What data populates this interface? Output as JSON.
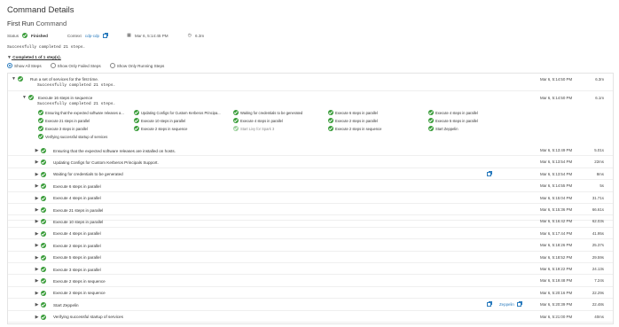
{
  "page": {
    "title": "Command Details",
    "run_name": "First Run",
    "run_kind": "Command"
  },
  "status_line": {
    "status_label": "Status",
    "status_value": "Finished",
    "context_label": "Context",
    "context_value": "cdp-cdp",
    "started": "Mar 6, 5:14:45 PM",
    "duration": "6.3m"
  },
  "summary": "Successfully completed 21 steps.",
  "completed_toggle": "Completed 1 of 1 step(s).",
  "filters": {
    "all": "Show All Steps",
    "failed": "Show Only Failed Steps",
    "running": "Show Only Running Steps"
  },
  "root": {
    "name": "Run a set of services for the first time.",
    "message": "Successfully completed 21 steps.",
    "time": "Mar 6, 5:14:50 PM",
    "duration": "6.3m"
  },
  "sequence": {
    "name": "Execute 16 steps in sequence",
    "message": "Successfully completed 21 steps.",
    "time": "Mar 6, 5:14:50 PM",
    "duration": "6.1m"
  },
  "grid": [
    {
      "label": "Ensuring that the expected software releases a...",
      "state": "ok"
    },
    {
      "label": "Updating Configs for Custom Kerberos Principa...",
      "state": "ok"
    },
    {
      "label": "Waiting for credentials to be generated",
      "state": "ok"
    },
    {
      "label": "Execute 6 steps in parallel",
      "state": "ok"
    },
    {
      "label": "Execute 4 steps in parallel",
      "state": "ok"
    },
    {
      "label": "Execute 21 steps in parallel",
      "state": "ok"
    },
    {
      "label": "Execute 10 steps in parallel",
      "state": "ok"
    },
    {
      "label": "Execute 4 steps in parallel",
      "state": "ok"
    },
    {
      "label": "Execute 2 steps in parallel",
      "state": "ok"
    },
    {
      "label": "Execute 5 steps in parallel",
      "state": "ok"
    },
    {
      "label": "Execute 3 steps in parallel",
      "state": "ok"
    },
    {
      "label": "Execute 2 steps in sequence",
      "state": "ok"
    },
    {
      "label": "Start Livy for Spark 3",
      "state": "gray"
    },
    {
      "label": "Execute 2 steps in sequence",
      "state": "ok"
    },
    {
      "label": "Start Zeppelin",
      "state": "ok"
    },
    {
      "label": "Verifying successful startup of services",
      "state": "ok"
    }
  ],
  "steps": [
    {
      "name": "Ensuring that the expected software releases are installed on hosts.",
      "time": "Mar 6, 5:13:49 PM",
      "duration": "5.01s"
    },
    {
      "name": "Updating Configs for Custom Kerberos Principals Support.",
      "time": "Mar 6, 5:13:54 PM",
      "duration": "22ms"
    },
    {
      "name": "Waiting for credentials to be generated",
      "time": "Mar 6, 5:13:54 PM",
      "duration": "8ms",
      "link_icon": true
    },
    {
      "name": "Execute 6 steps in parallel",
      "time": "Mar 6, 5:14:55 PM",
      "duration": "5s"
    },
    {
      "name": "Execute 4 steps in parallel",
      "time": "Mar 6, 5:15:04 PM",
      "duration": "31.71s"
    },
    {
      "name": "Execute 21 steps in parallel",
      "time": "Mar 6, 5:15:36 PM",
      "duration": "66.61s"
    },
    {
      "name": "Execute 10 steps in parallel",
      "time": "Mar 6, 5:16:42 PM",
      "duration": "62.03s"
    },
    {
      "name": "Execute 4 steps in parallel",
      "time": "Mar 6, 5:17:44 PM",
      "duration": "41.95s"
    },
    {
      "name": "Execute 2 steps in parallel",
      "time": "Mar 6, 5:18:26 PM",
      "duration": "25.37s"
    },
    {
      "name": "Execute 5 steps in parallel",
      "time": "Mar 6, 5:18:52 PM",
      "duration": "29.59s"
    },
    {
      "name": "Execute 3 steps in parallel",
      "time": "Mar 6, 5:19:22 PM",
      "duration": "24.13s"
    },
    {
      "name": "Execute 2 steps in sequence",
      "time": "Mar 6, 5:19:48 PM",
      "duration": "7.24s"
    },
    {
      "name": "Execute 2 steps in sequence",
      "time": "Mar 6, 5:20:16 PM",
      "duration": "22.29s"
    },
    {
      "name": "Start Zeppelin",
      "time": "Mar 6, 5:20:39 PM",
      "duration": "22.48s",
      "link_icon": true,
      "link_text": "Zeppelin"
    },
    {
      "name": "Verifying successful startup of services",
      "time": "Mar 6, 5:21:00 PM",
      "duration": "40ms"
    }
  ],
  "colors": {
    "success": "#3a9d3a",
    "link": "#2a7bbd"
  }
}
